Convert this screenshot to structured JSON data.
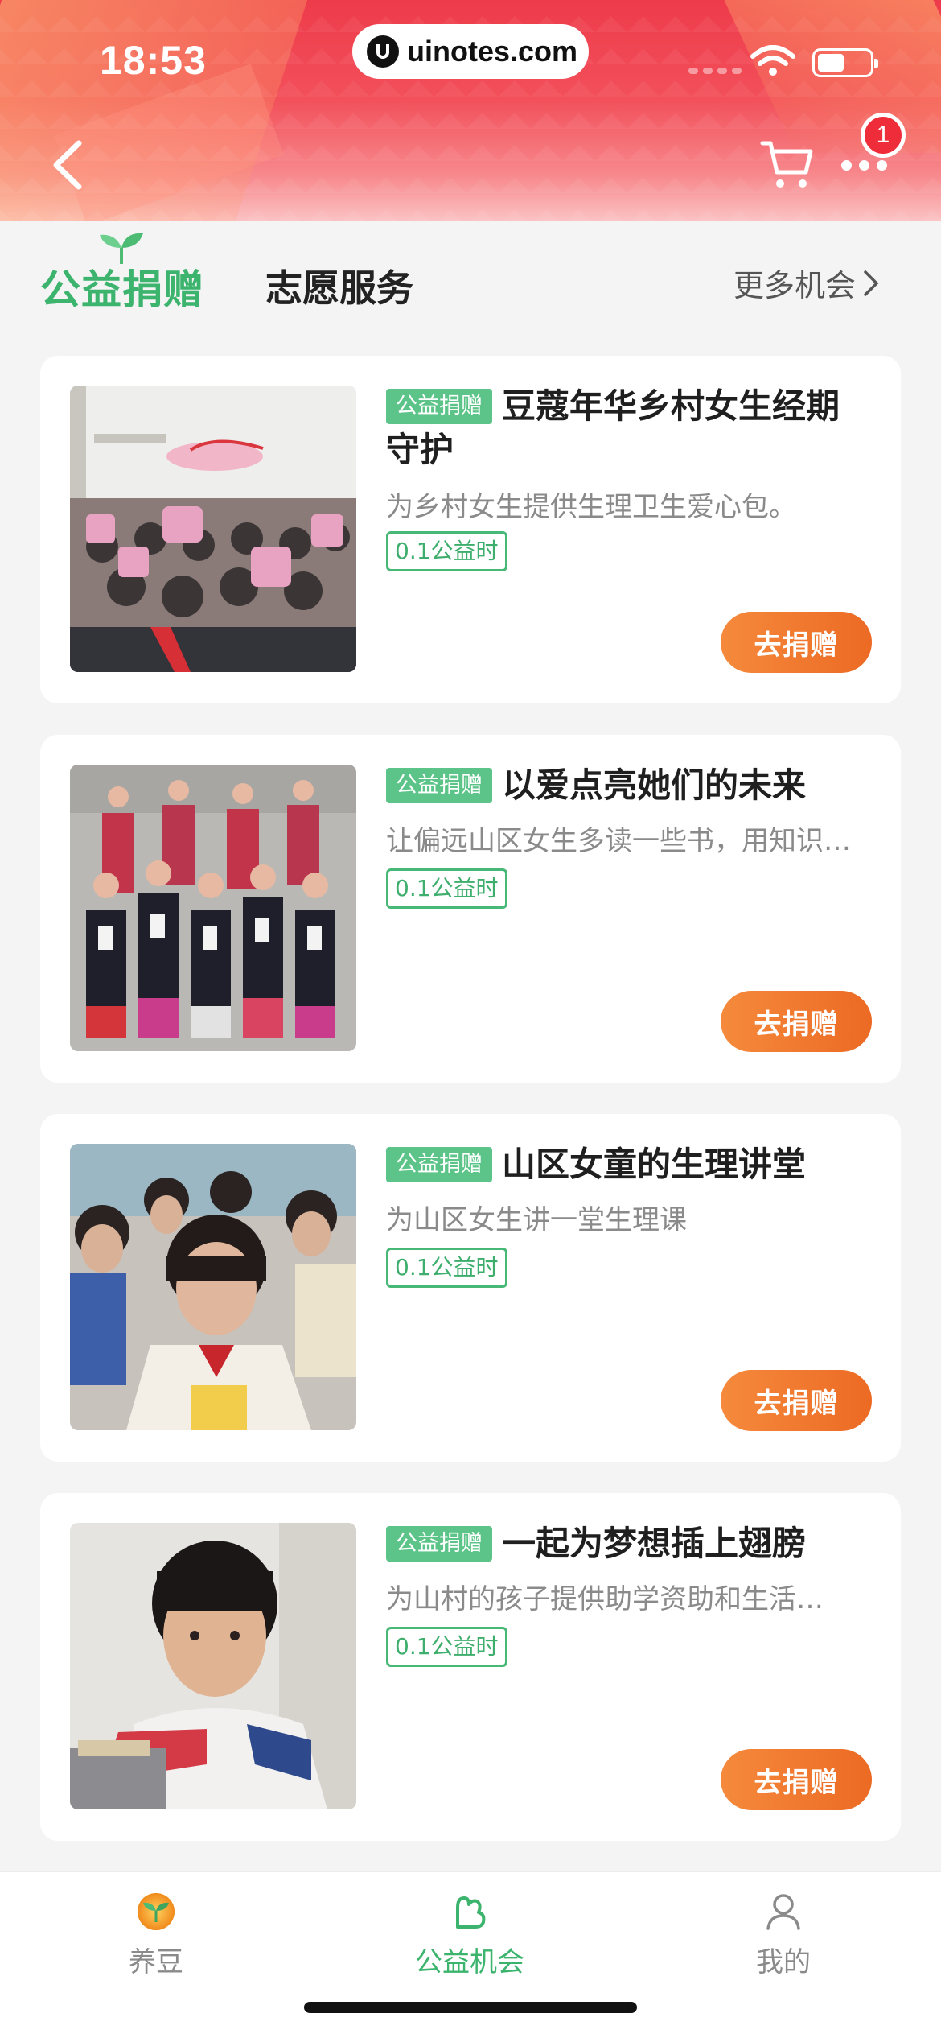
{
  "status_bar": {
    "time": "18:53",
    "url": "uinotes.com"
  },
  "header": {
    "cart_badge": "1"
  },
  "tabs": {
    "active": "公益捐赠",
    "inactive": "志愿服务",
    "more": "更多机会"
  },
  "projects": [
    {
      "tag": "公益捐赠",
      "title": "豆蔻年华乡村女生经期守护",
      "desc": "为乡村女生提供生理卫生爱心包。",
      "hours": "0.1公益时",
      "button": "去捐赠"
    },
    {
      "tag": "公益捐赠",
      "title": "以爱点亮她们的未来",
      "desc": "让偏远山区女生多读一些书，用知识…",
      "hours": "0.1公益时",
      "button": "去捐赠"
    },
    {
      "tag": "公益捐赠",
      "title": "山区女童的生理讲堂",
      "desc": "为山区女生讲一堂生理课",
      "hours": "0.1公益时",
      "button": "去捐赠"
    },
    {
      "tag": "公益捐赠",
      "title": "一起为梦想插上翅膀",
      "desc": "为山村的孩子提供助学资助和生活…",
      "hours": "0.1公益时",
      "button": "去捐赠"
    }
  ],
  "bottom_nav": [
    {
      "label": "养豆",
      "icon": "bean-sprout-icon",
      "active": false
    },
    {
      "label": "公益机会",
      "icon": "charity-hand-icon",
      "active": true
    },
    {
      "label": "我的",
      "icon": "person-icon",
      "active": false
    }
  ],
  "colors": {
    "brand_green": "#3cb46e",
    "tag_green": "#5cc488",
    "button_orange": "#ec6a24",
    "header_red": "#ee3b4b"
  }
}
